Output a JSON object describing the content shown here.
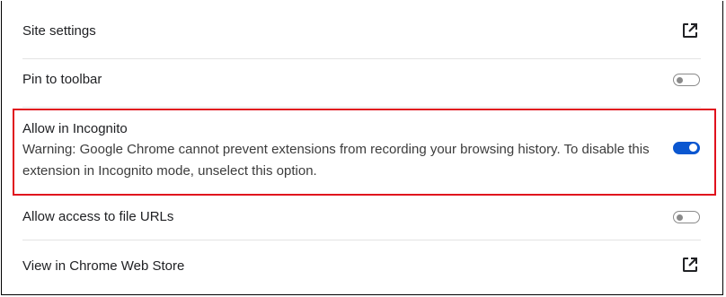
{
  "settings": {
    "site_settings": {
      "label": "Site settings",
      "icon": "open-in-new-icon"
    },
    "pin_to_toolbar": {
      "label": "Pin to toolbar",
      "enabled": false
    },
    "allow_incognito": {
      "label": "Allow in Incognito",
      "warning": "Warning: Google Chrome cannot prevent extensions from recording your browsing history. To disable this extension in Incognito mode, unselect this option.",
      "enabled": true
    },
    "allow_file_urls": {
      "label": "Allow access to file URLs",
      "enabled": false
    },
    "view_in_store": {
      "label": "View in Chrome Web Store",
      "icon": "open-in-new-icon"
    }
  },
  "colors": {
    "toggle_on": "#0b57d0",
    "toggle_off": "#8a8a8a",
    "highlight": "#e0111d"
  }
}
